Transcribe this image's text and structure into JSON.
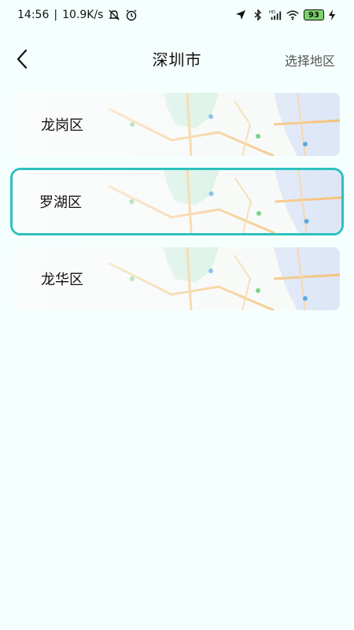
{
  "status_bar": {
    "time": "14:56",
    "net_speed": "10.9K/s",
    "battery_level": "93",
    "icons": [
      "mute-icon",
      "alarm-icon",
      "location-icon",
      "bluetooth-icon",
      "signal-hd-icon",
      "wifi-icon",
      "charging-icon"
    ]
  },
  "header": {
    "title": "深圳市",
    "action_label": "选择地区",
    "back_icon": "chevron-left-icon"
  },
  "districts": [
    {
      "name": "龙岗区",
      "selected": false
    },
    {
      "name": "罗湖区",
      "selected": true
    },
    {
      "name": "龙华区",
      "selected": false
    }
  ],
  "colors": {
    "accent": "#2cc1bf",
    "background": "#f5fffe",
    "map_green": "#cdeedd",
    "map_road": "#f5c27a",
    "map_blue": "#dde6f7"
  }
}
